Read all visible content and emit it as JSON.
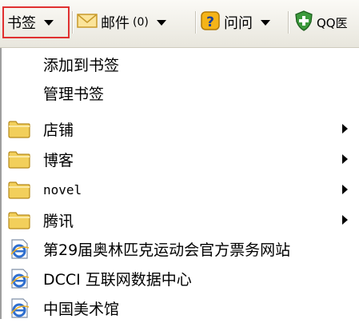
{
  "toolbar": {
    "bookmarks_label": "书签",
    "mail_label": "邮件",
    "mail_count": "(0)",
    "ask_label": "问问",
    "qq_label": "QQ医"
  },
  "menu": {
    "add_bookmark": "添加到书签",
    "manage_bookmarks": "管理书签",
    "folders": [
      {
        "label": "店铺"
      },
      {
        "label": "博客"
      },
      {
        "label": "novel"
      },
      {
        "label": "腾讯"
      }
    ],
    "links": [
      {
        "label": "第29届奥林匹克运动会官方票务网站"
      },
      {
        "label": "DCCI 互联网数据中心"
      },
      {
        "label": "中国美术馆"
      }
    ]
  },
  "colors": {
    "highlight_border": "#e03030",
    "folder": "#f2cf5b",
    "ie_blue": "#2f6fcf"
  }
}
